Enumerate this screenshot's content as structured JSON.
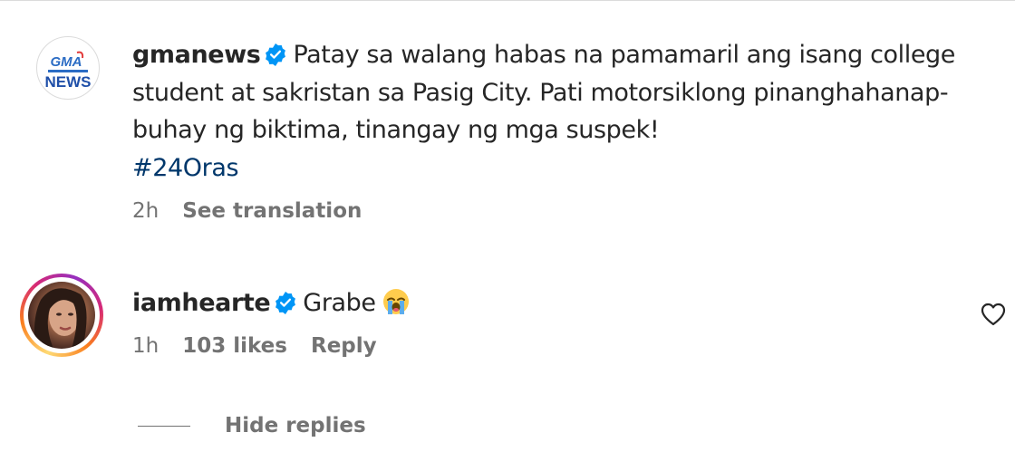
{
  "post": {
    "username": "gmanews",
    "avatar_icon": "gma-news-logo",
    "caption": "Patay sa walang habas na pamamaril ang isang college student at sakristan sa Pasig City. Pati motorsiklong pinanghahanap-buhay ng biktima, tinangay ng mga suspek!",
    "hashtag": "#24Oras",
    "time": "2h",
    "see_translation": "See translation",
    "logo_text": "GMA",
    "logo_text2": "NEWS"
  },
  "reply": {
    "username": "iamhearte",
    "text": "Grabe",
    "emoji": "loudly-crying-face",
    "time": "1h",
    "likes": "103 likes",
    "reply_label": "Reply"
  },
  "thread": {
    "hide_replies": "Hide replies"
  },
  "colors": {
    "text": "#262626",
    "secondary": "#737373",
    "verified": "#0095f6",
    "hashtag": "#00376b"
  }
}
